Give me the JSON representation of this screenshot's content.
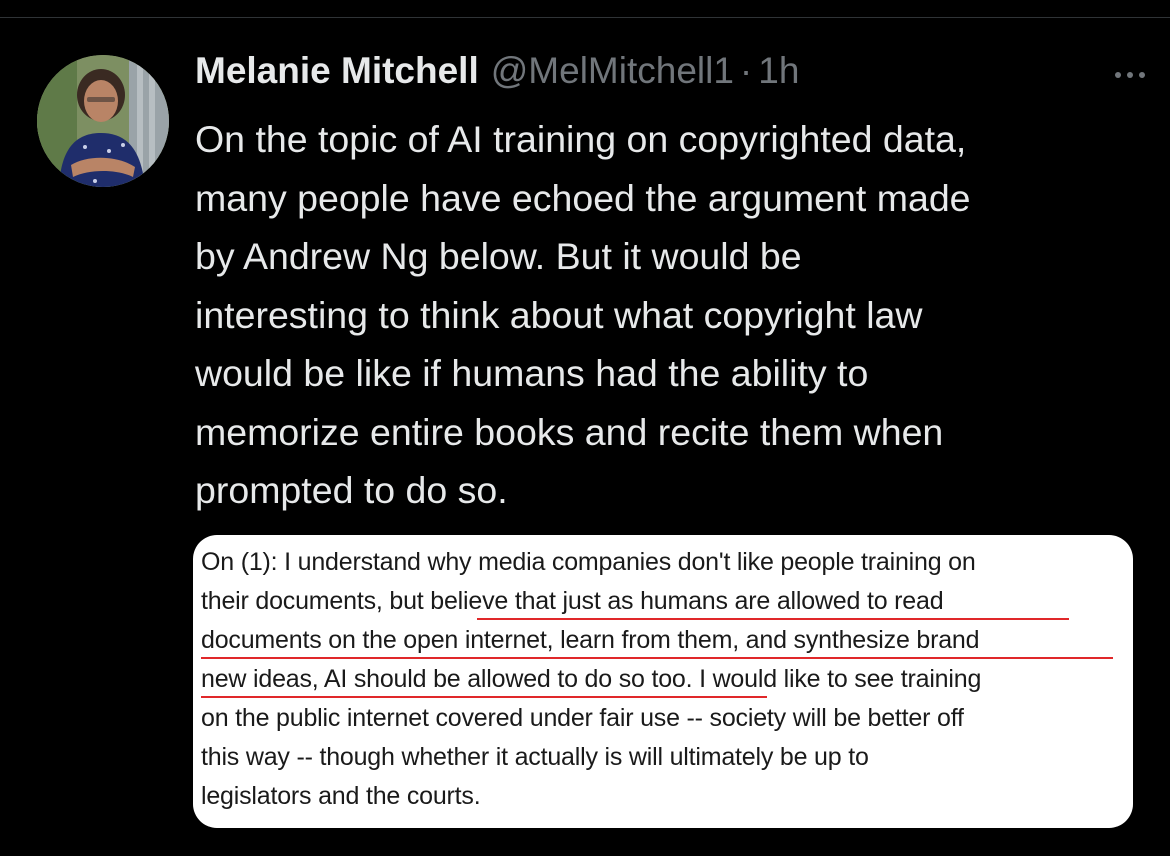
{
  "tweet": {
    "author_name": "Melanie Mitchell",
    "handle": "@MelMitchell1",
    "separator": "·",
    "time": "1h",
    "more_icon": "more-horizontal-icon",
    "text_lines": [
      "On the topic of AI training on copyrighted data,",
      "many people have echoed the argument made",
      "by Andrew Ng below.  But it would be",
      "interesting to think about what copyright law",
      "would be like if humans had the ability to",
      "memorize entire books and recite them when",
      "prompted to do so."
    ]
  },
  "quote_image": {
    "lines": [
      "On (1): I understand why media companies don't like people training on",
      "their documents, but believe that just as humans are allowed to read",
      "documents on the open internet, learn from them, and synthesize brand",
      "new ideas, AI should be allowed to do so too. I would like to see training",
      "on the public internet covered under fair use -- society will be better off",
      "this way -- though whether it actually is will ultimately be up to",
      "legislators and the courts."
    ],
    "underline_color": "#e0282a"
  },
  "colors": {
    "background": "#000000",
    "primary_text": "#e7e9ea",
    "secondary_text": "#71767b"
  }
}
